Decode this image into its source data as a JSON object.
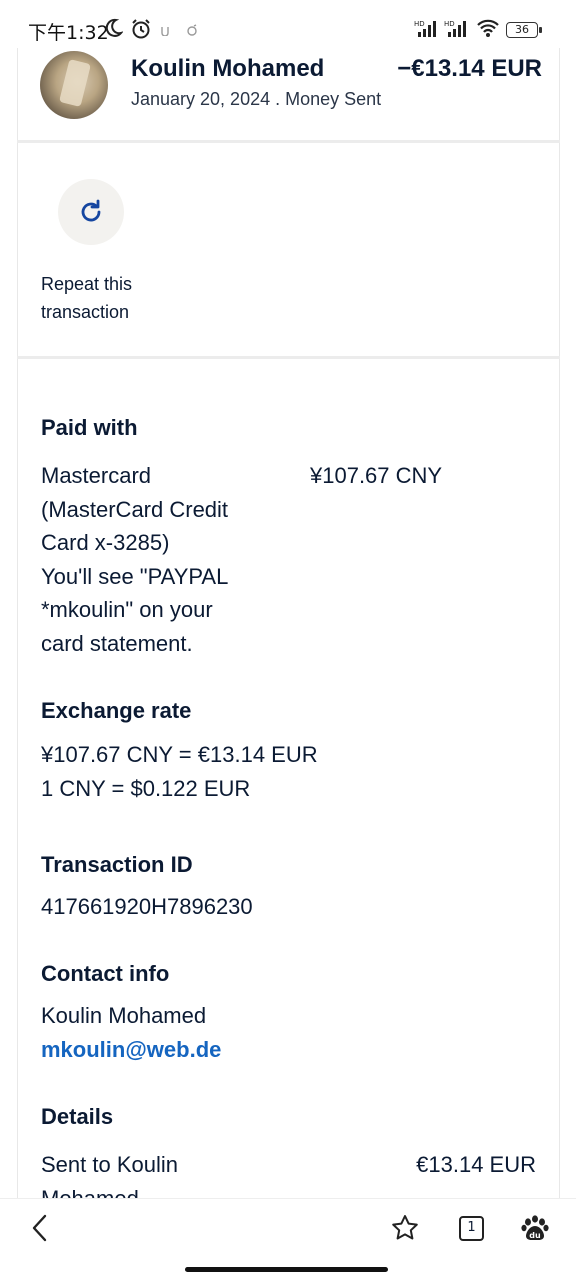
{
  "status_bar": {
    "time": "下午1:32",
    "battery": "36"
  },
  "header": {
    "name": "Koulin Mohamed",
    "amount": "−€13.14 EUR",
    "subtitle": "January 20, 2024 . Money Sent"
  },
  "repeat": {
    "label": "Repeat this transaction"
  },
  "paid_with": {
    "heading": "Paid with",
    "method_lines": [
      "Mastercard",
      "(MasterCard Credit",
      "Card x-3285)",
      "You'll see \"PAYPAL",
      "*mkoulin\" on your",
      "card statement."
    ],
    "amount": "¥107.67 CNY"
  },
  "exchange": {
    "heading": "Exchange rate",
    "line1": "¥107.67 CNY = €13.14 EUR",
    "line2": "1 CNY = $0.122 EUR"
  },
  "transaction": {
    "heading": "Transaction ID",
    "id": "417661920H7896230"
  },
  "contact": {
    "heading": "Contact info",
    "name": "Koulin Mohamed",
    "email": "mkoulin@web.de"
  },
  "details": {
    "heading": "Details",
    "sent_to_lines": [
      "Sent to Koulin",
      "Mohamed"
    ],
    "amount": "€13.14 EUR"
  },
  "bottom_nav": {
    "tab_count": "1"
  },
  "icons": [
    "moon-icon",
    "alarm-icon",
    "signal-icon",
    "wifi-icon",
    "battery-icon",
    "repeat-icon",
    "back-icon",
    "star-icon",
    "tabs-icon",
    "paw-icon"
  ],
  "colors": {
    "accent": "#1565c0",
    "text": "#0b1a33",
    "repeat_bg": "#f3f2ef"
  }
}
